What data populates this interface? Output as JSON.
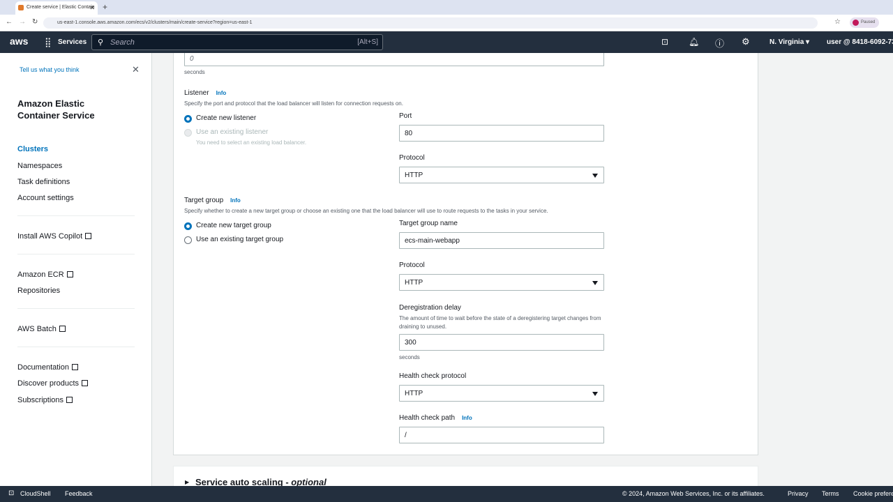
{
  "browser": {
    "tab_title": "Create service | Elastic Contain",
    "url": "us-east-1.console.aws.amazon.com/ecs/v2/clusters/main/create-service?region=us-east-1",
    "profile": "Paused"
  },
  "topnav": {
    "logo": "aws",
    "services": "Services",
    "search_placeholder": "Search",
    "search_shortcut": "[Alt+S]",
    "region": "N. Virginia",
    "account": "user @ 8418-6092-73"
  },
  "sidebar": {
    "feedback": "Tell us what you think",
    "title": "Amazon Elastic Container Service",
    "items": [
      {
        "label": "Clusters"
      },
      {
        "label": "Namespaces"
      },
      {
        "label": "Task definitions"
      },
      {
        "label": "Account settings"
      },
      {
        "label": "Install AWS Copilot"
      },
      {
        "label": "Amazon ECR"
      },
      {
        "label": "Repositories"
      },
      {
        "label": "AWS Batch"
      },
      {
        "label": "Documentation"
      },
      {
        "label": "Discover products"
      },
      {
        "label": "Subscriptions"
      }
    ]
  },
  "form": {
    "top_value": "0",
    "top_unit": "seconds",
    "listener": {
      "title": "Listener",
      "info": "Info",
      "desc": "Specify the port and protocol that the load balancer will listen for connection requests on.",
      "opt_new": "Create new listener",
      "opt_existing": "Use an existing listener",
      "existing_hint": "You need to select an existing load balancer.",
      "port_label": "Port",
      "port_value": "80",
      "protocol_label": "Protocol",
      "protocol_value": "HTTP"
    },
    "target_group": {
      "title": "Target group",
      "info": "Info",
      "desc": "Specify whether to create a new target group or choose an existing one that the load balancer will use to route requests to the tasks in your service.",
      "opt_new": "Create new target group",
      "opt_existing": "Use an existing target group",
      "name_label": "Target group name",
      "name_value": "ecs-main-webapp",
      "protocol_label": "Protocol",
      "protocol_value": "HTTP",
      "dereg_label": "Deregistration delay",
      "dereg_desc": "The amount of time to wait before the state of a deregistering target changes from draining to unused.",
      "dereg_value": "300",
      "dereg_unit": "seconds",
      "hc_protocol_label": "Health check protocol",
      "hc_protocol_value": "HTTP",
      "hc_path_label": "Health check path",
      "hc_path_info": "Info",
      "hc_path_value": "/"
    },
    "autoscaling": {
      "title": "Service auto scaling - ",
      "optional": "optional"
    }
  },
  "footer": {
    "cloudshell": "CloudShell",
    "feedback": "Feedback",
    "copyright": "© 2024, Amazon Web Services, Inc. or its affiliates.",
    "privacy": "Privacy",
    "terms": "Terms",
    "cookies": "Cookie preferences"
  }
}
